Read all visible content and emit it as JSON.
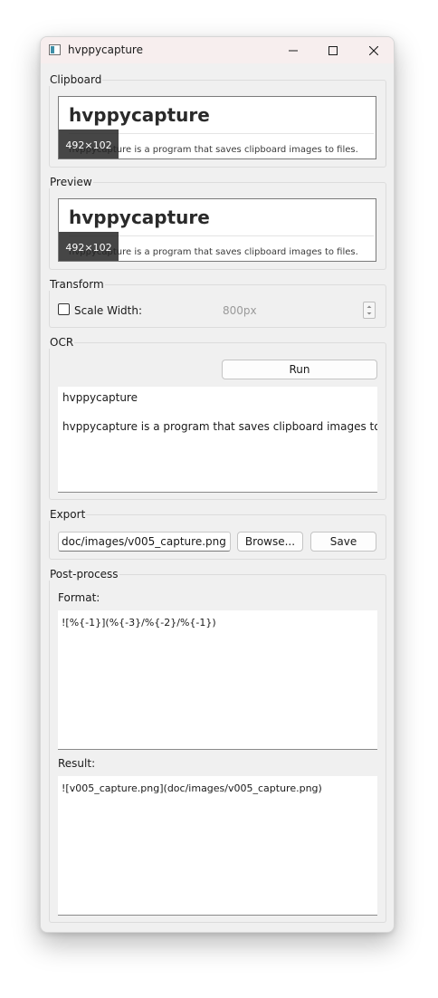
{
  "window": {
    "title": "hvppycapture"
  },
  "clipboard": {
    "label": "Clipboard",
    "heading": "hvppycapture",
    "subtext": "hvppycapture is a program that saves clipboard images to files.",
    "size": "492×102"
  },
  "preview": {
    "label": "Preview",
    "heading": "hvppycapture",
    "subtext": "hvppycapture is a program that saves clipboard images to files.",
    "size": "492×102"
  },
  "transform": {
    "label": "Transform",
    "scale_width_label": "Scale Width:",
    "scale_width_checked": false,
    "scale_width_value": "800px"
  },
  "ocr": {
    "label": "OCR",
    "run_label": "Run",
    "text_line1": "hvppycapture",
    "text_line2": "hvppycapture is a program that saves clipboard images to files."
  },
  "export": {
    "label": "Export",
    "path": "doc/images/v005_capture.png",
    "browse_label": "Browse...",
    "save_label": "Save"
  },
  "postprocess": {
    "label": "Post-process",
    "format_label": "Format:",
    "format_value": "![%{-1}](%{-3}/%{-2}/%{-1})",
    "result_label": "Result:",
    "result_value": "![v005_capture.png](doc/images/v005_capture.png)"
  }
}
